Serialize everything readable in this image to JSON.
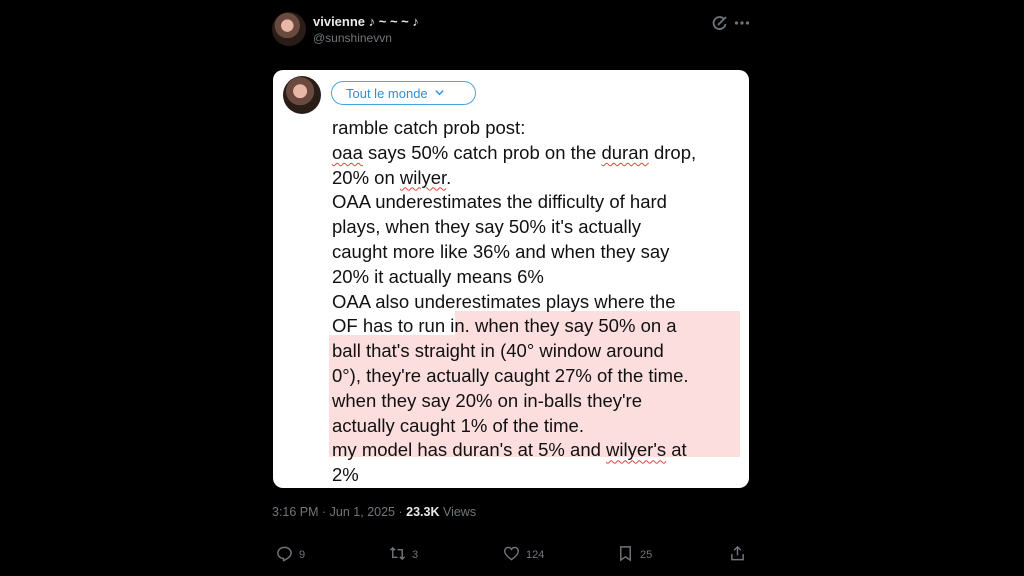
{
  "author": {
    "name": "vivienne ♪ ~ ~ ~ ♪",
    "handle": "@sunshinevvn"
  },
  "card": {
    "audience_label": "Tout le monde",
    "lines": [
      "ramble catch prob post:",
      "oaa says 50% catch prob on the duran drop,",
      "20% on wilyer.",
      "OAA underestimates the difficulty of hard",
      "plays, when they say 50% it's actually",
      "caught more like 36% and when they say",
      "20% it actually means 6%",
      "OAA also underestimates plays where the",
      "OF has to run in. when they say 50% on a",
      "ball that's straight in (40° window around",
      "0°), they're actually caught 27% of the time.",
      "when they say 20% on in-balls they're",
      "actually caught 1% of the time.",
      "my model has duran's at 5% and wilyer's at",
      "2%"
    ]
  },
  "meta": {
    "time": "3:16 PM",
    "date": "Jun 1, 2025",
    "views_count": "23.3K",
    "views_label": "Views"
  },
  "actions": {
    "replies": "9",
    "reposts": "3",
    "likes": "124",
    "bookmarks": "25"
  },
  "icons": [
    "grok-icon",
    "more-icon",
    "reply-icon",
    "repost-icon",
    "like-icon",
    "bookmark-icon",
    "share-icon",
    "chevron-down-icon"
  ],
  "colors": {
    "background": "#000000",
    "card": "#ffffff",
    "highlight": "#fcdede",
    "accent": "#2f8fd6",
    "muted": "#71767b"
  }
}
